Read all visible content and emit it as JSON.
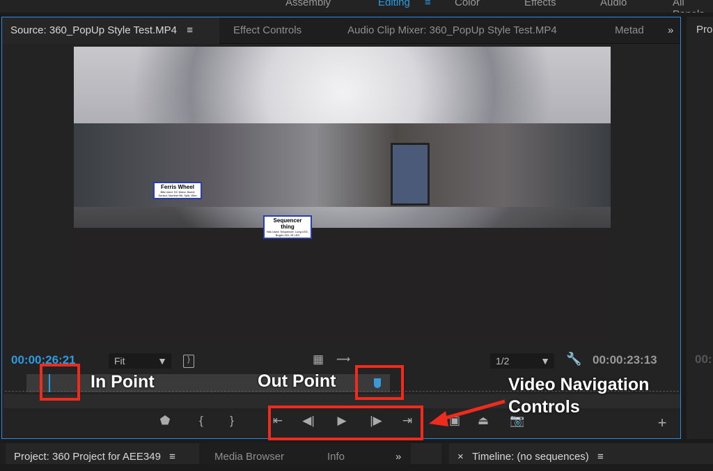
{
  "workspaces": [
    "Assembly",
    "Editing",
    "Color",
    "Effects",
    "Audio",
    "All Panels"
  ],
  "active_workspace": "Editing",
  "source_panel": {
    "tabs": [
      "Source: 360_PopUp Style Test.MP4",
      "Effect Controls",
      "Audio Clip Mixer: 360_PopUp Style Test.MP4",
      "Metad"
    ],
    "overflow": "»",
    "video_labels": {
      "ferris_title": "Ferris Wheel",
      "ferris_sub": "Bits Used: DC Motor, Barrel Sensor, Number Bit, Split, Wire",
      "seq_title": "Sequencer thing",
      "seq_sub": "Bits Used: Sequencer, Long LED, Bright LED, IR LED"
    },
    "current_time": "00:00:26:21",
    "zoom": "Fit",
    "resolution": "1/2",
    "duration": "00:00:23:13"
  },
  "annotations": {
    "in_point": "In Point",
    "out_point": "Out Point",
    "nav_line1": "Video Navigation",
    "nav_line2": "Controls"
  },
  "right_panel": {
    "tab": "Pro",
    "timecode": "00:"
  },
  "bottom": {
    "tabs": [
      "Project: 360 Project for AEE349",
      "Media Browser",
      "Info"
    ],
    "overflow": "»",
    "timeline_close": "×",
    "timeline_tab": "Timeline: (no sequences)"
  },
  "colors": {
    "accent": "#2d8ceb",
    "annotation": "#ef2b1e",
    "timecode": "#2d9be0"
  }
}
